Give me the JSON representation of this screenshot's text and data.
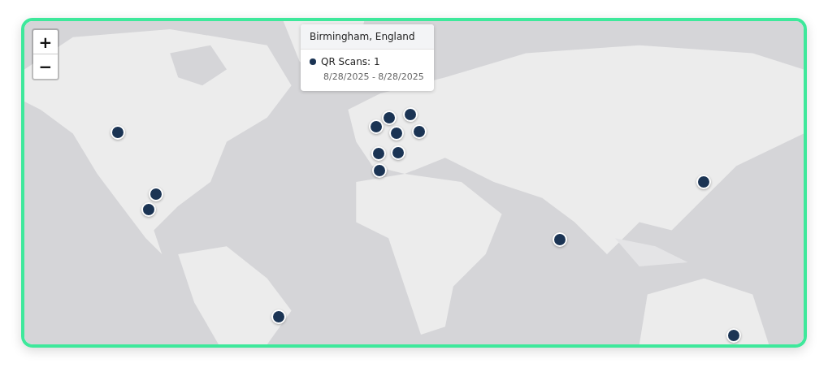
{
  "zoom_controls": [
    {
      "label": "+",
      "kind": "zoom-in"
    },
    {
      "label": "−",
      "kind": "zoom-out"
    }
  ],
  "tooltip": {
    "title": "Birmingham, England",
    "entries": [
      {
        "label": "QR Scans: 1",
        "date_range": "8/28/2025 - 8/28/2025"
      }
    ]
  }
}
